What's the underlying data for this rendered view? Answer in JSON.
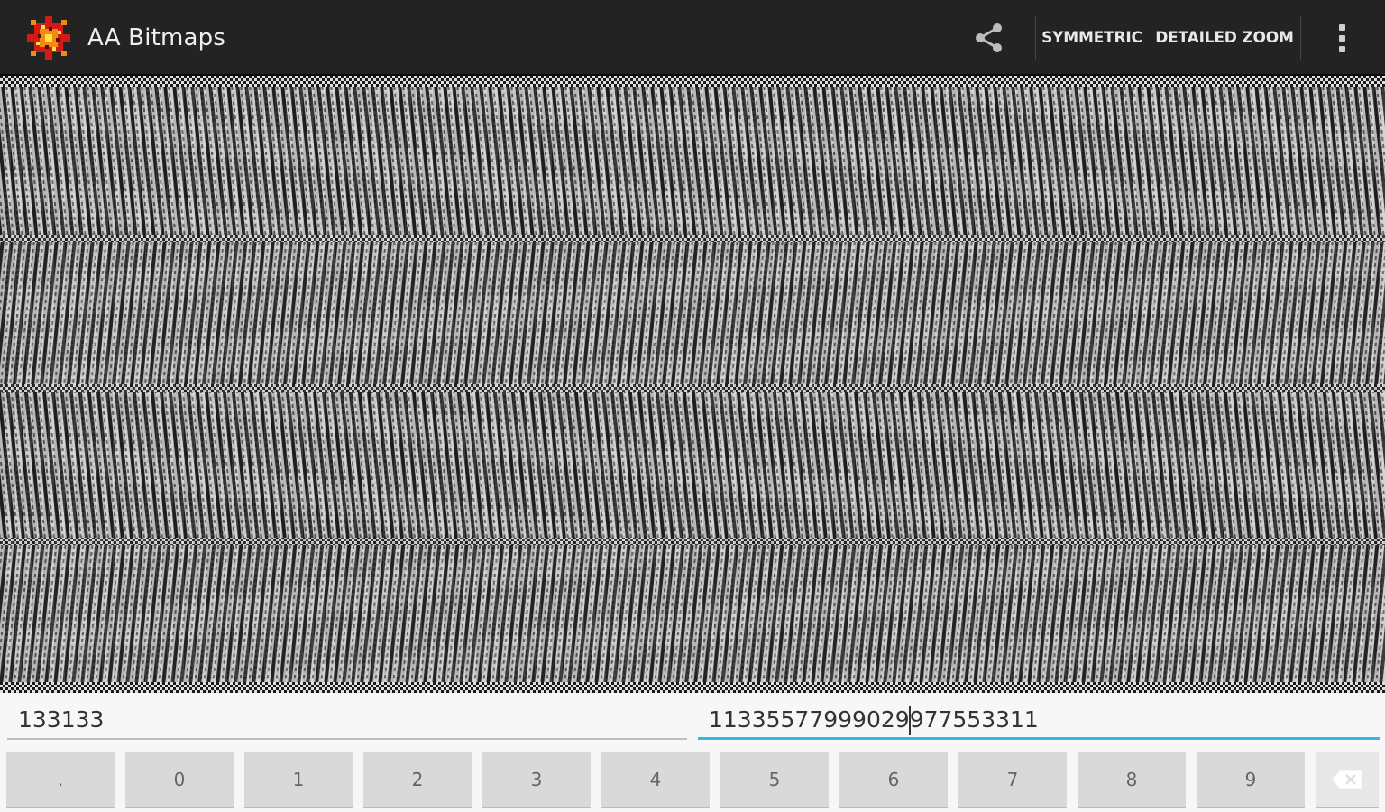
{
  "action_bar": {
    "title": "AA Bitmaps",
    "logo_icon": "colorful-fractal-logo-icon",
    "share_icon": "share-icon",
    "buttons": [
      "SYMMETRIC",
      "DETAILED ZOOM"
    ],
    "overflow_icon": "overflow-menu-icon"
  },
  "canvas": {
    "description_icon": "bitmap-pattern"
  },
  "inputs": {
    "left_value": "133133",
    "right_value_before_cursor": "11335577999029",
    "right_value_after_cursor": "977553311"
  },
  "keypad": {
    "keys": [
      ".",
      "0",
      "1",
      "2",
      "3",
      "4",
      "5",
      "6",
      "7",
      "8",
      "9"
    ],
    "delete_icon": "backspace-icon"
  },
  "colors": {
    "action_bar": "#232323",
    "accent": "#33b5e5",
    "key_bg": "#d9d9d9"
  }
}
